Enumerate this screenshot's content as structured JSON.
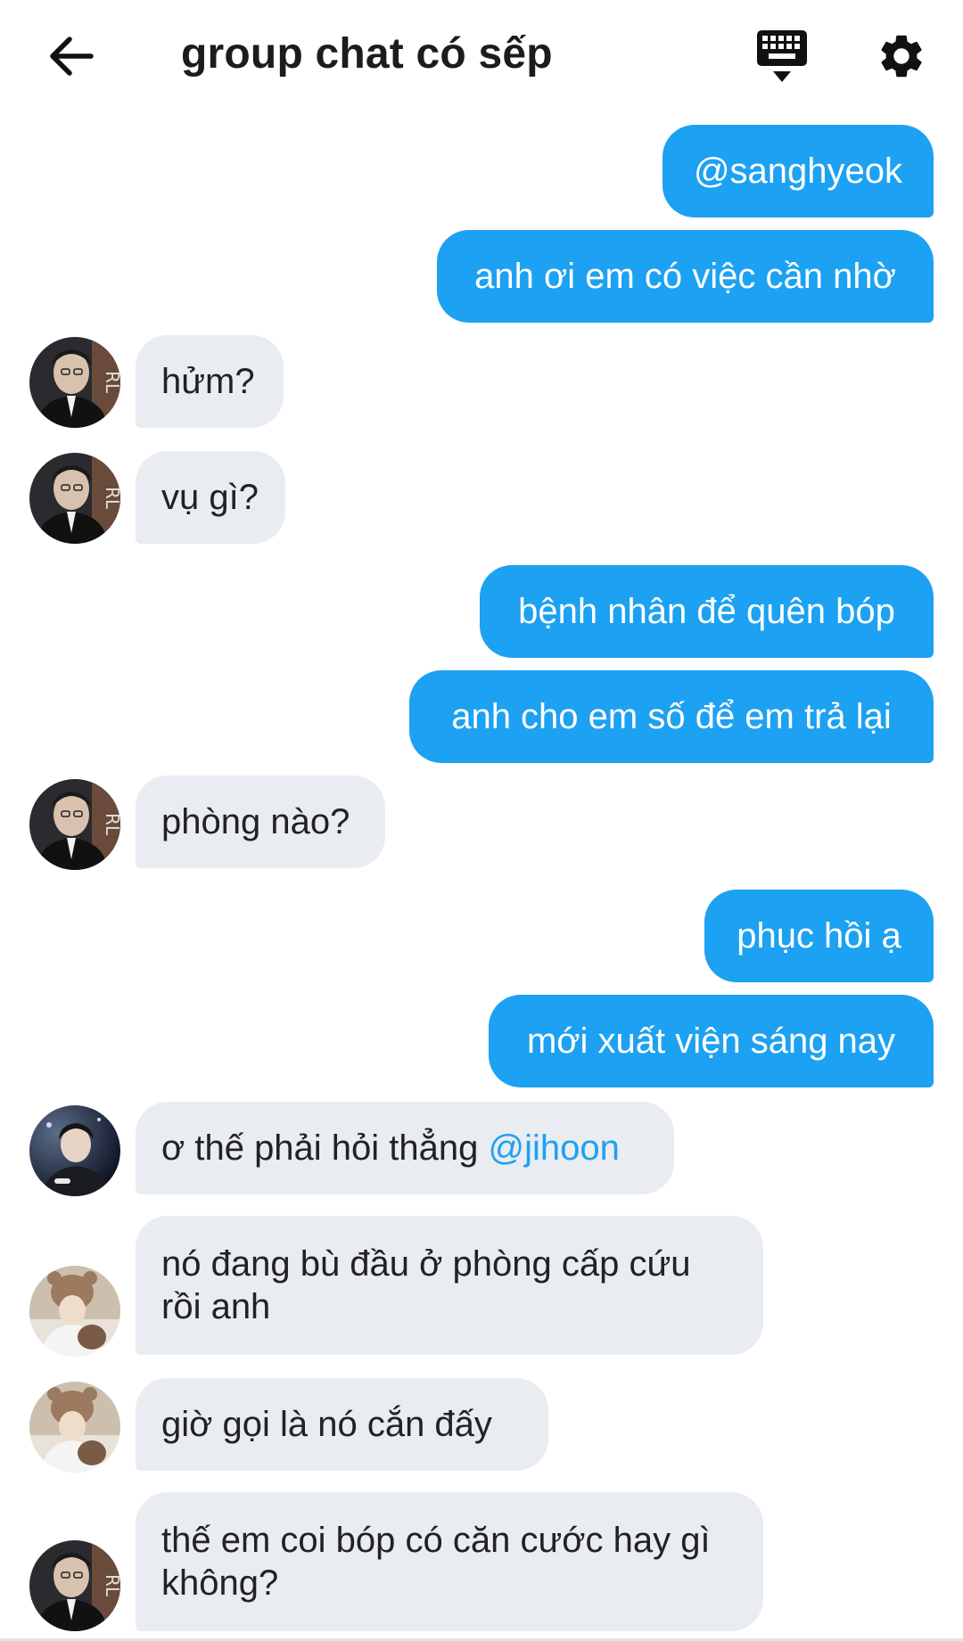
{
  "header": {
    "title": "group chat có sếp",
    "back_icon": "arrow-left-icon",
    "keyboard_icon": "keyboard-hide-icon",
    "settings_icon": "gear-icon"
  },
  "colors": {
    "outgoing_bubble": "#1da1f2",
    "incoming_bubble": "#e9ecf0",
    "mention": "#1da1f2"
  },
  "messages": [
    {
      "side": "out",
      "text": "@sanghyeok"
    },
    {
      "side": "out",
      "text": "anh ơi em có việc cần nhờ"
    },
    {
      "side": "in",
      "avatar": "avatar-a",
      "text": "hửm?"
    },
    {
      "side": "in",
      "avatar": "avatar-a",
      "text": "vụ gì?"
    },
    {
      "side": "out",
      "text": "bệnh nhân để quên bóp"
    },
    {
      "side": "out",
      "text": "anh cho em số để em trả lại"
    },
    {
      "side": "in",
      "avatar": "avatar-a",
      "text": "phòng nào?"
    },
    {
      "side": "out",
      "text": "phục hồi ạ"
    },
    {
      "side": "out",
      "text": "mới xuất viện sáng nay"
    },
    {
      "side": "in",
      "avatar": "avatar-b",
      "text": "ơ thế phải hỏi thẳng ",
      "mention": "@jihoon"
    },
    {
      "side": "in",
      "avatar": "avatar-c",
      "text": "nó đang bù đầu ở phòng cấp cứu rồi anh"
    },
    {
      "side": "in",
      "avatar": "avatar-c",
      "text": "giờ gọi là nó cắn đấy"
    },
    {
      "side": "in",
      "avatar": "avatar-a",
      "text": "thế em coi bóp có căn cước hay gì không?"
    }
  ]
}
